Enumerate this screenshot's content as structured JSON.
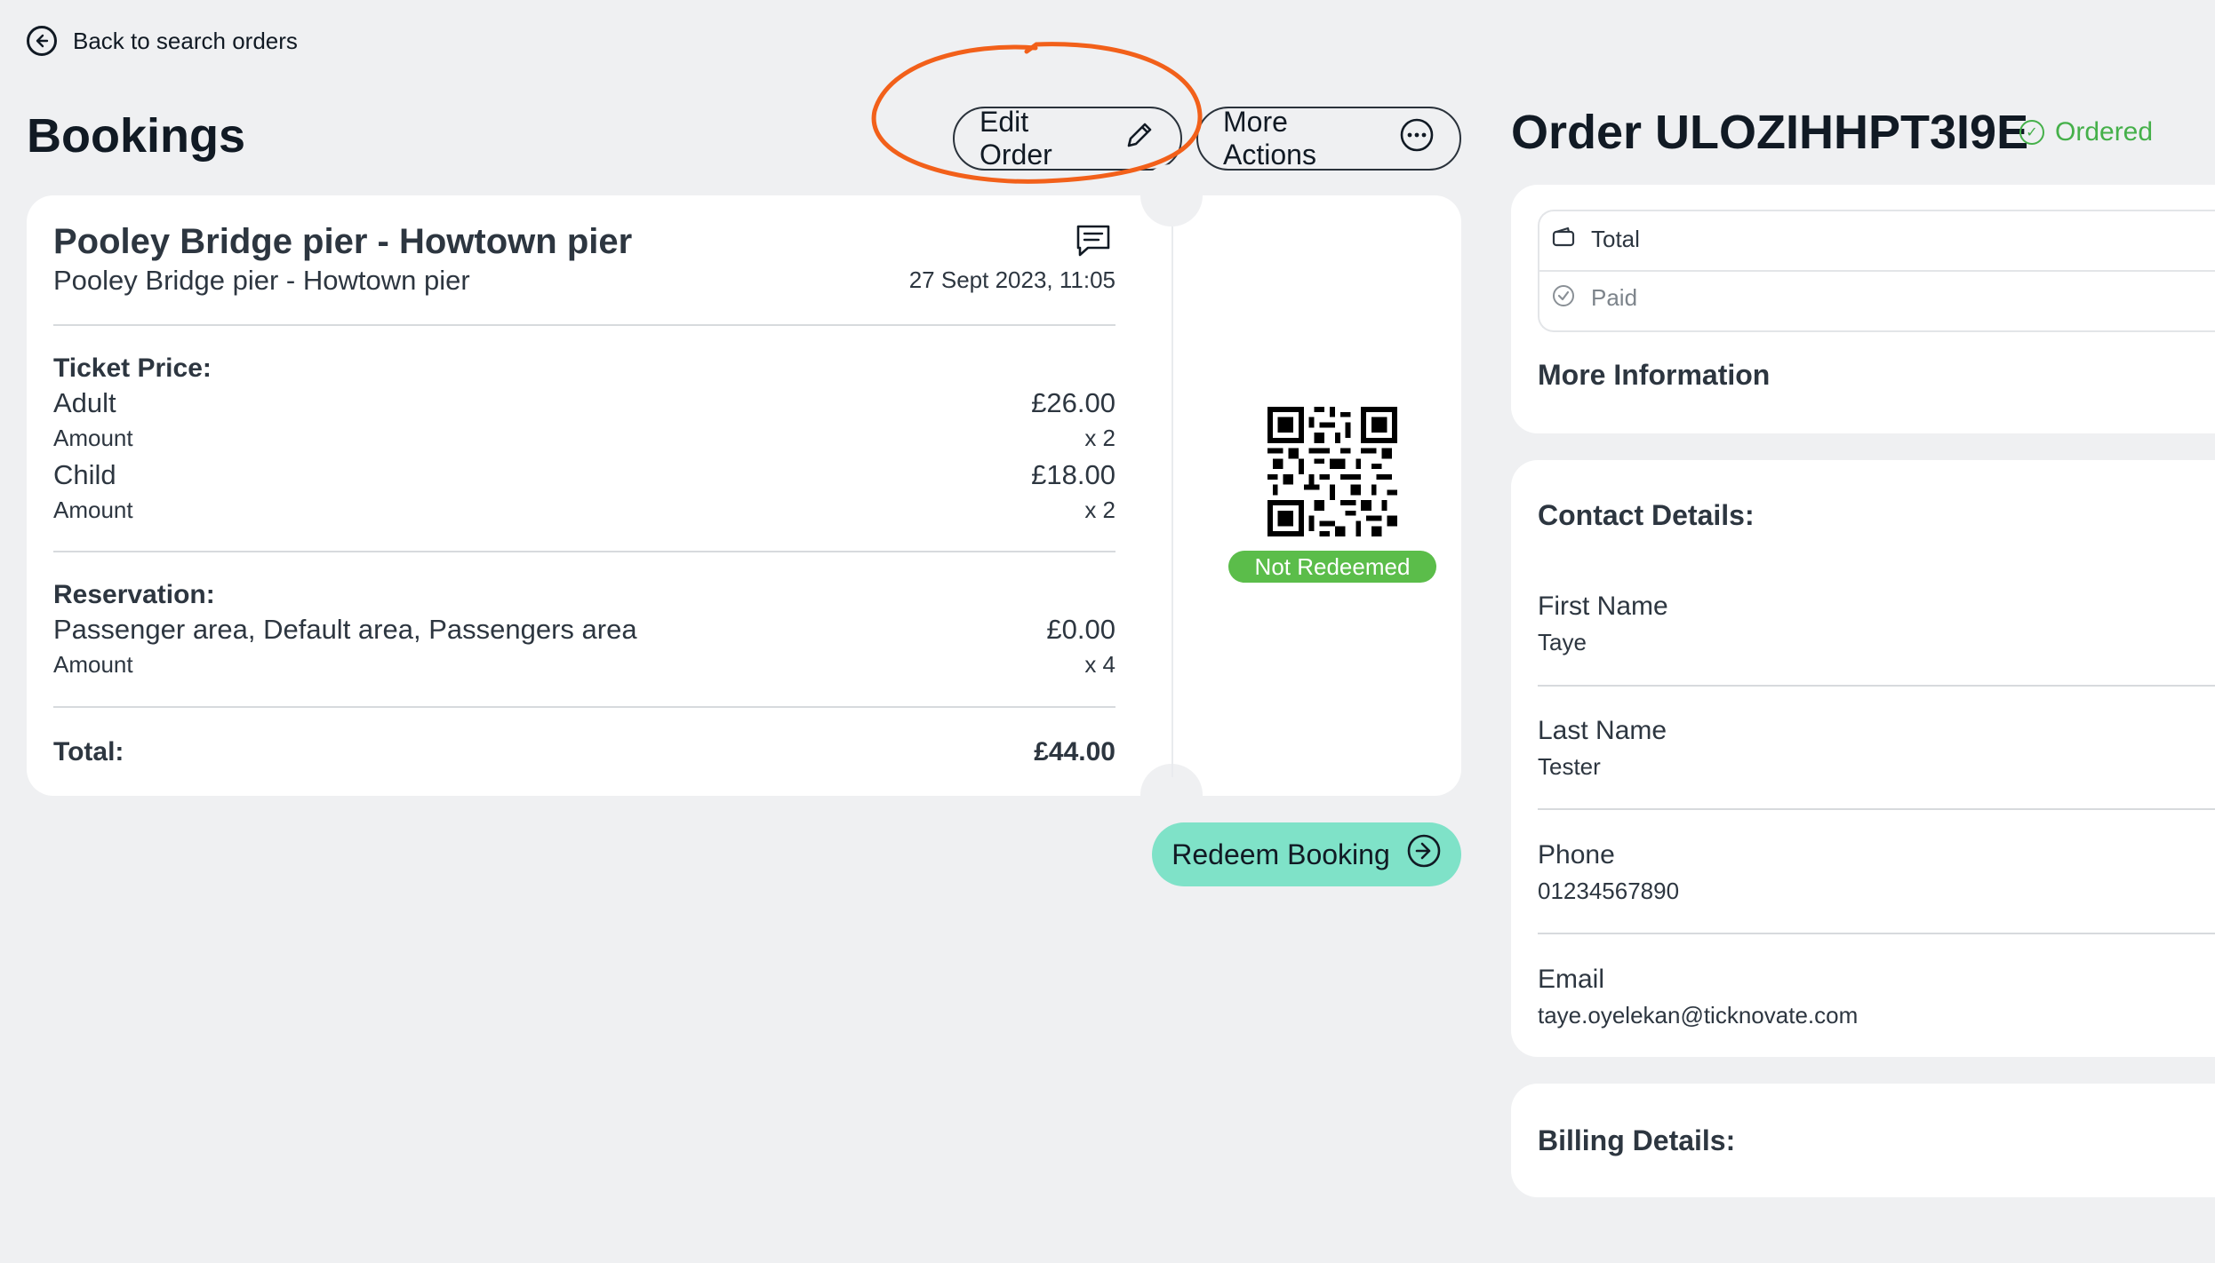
{
  "nav": {
    "back_label": "Back to search orders"
  },
  "page": {
    "title": "Bookings"
  },
  "actions": {
    "edit_order": "Edit Order",
    "more_actions": "More Actions"
  },
  "booking": {
    "title": "Pooley Bridge pier - Howtown pier",
    "subtitle": "Pooley Bridge pier - Howtown pier",
    "datetime": "27 Sept 2023, 11:05",
    "ticket_price_label": "Ticket Price:",
    "tickets": [
      {
        "name": "Adult",
        "price": "£26.00",
        "amount_label": "Amount",
        "qty": "x 2"
      },
      {
        "name": "Child",
        "price": "£18.00",
        "amount_label": "Amount",
        "qty": "x 2"
      }
    ],
    "reservation_label": "Reservation:",
    "reservation": {
      "name": "Passenger area, Default area, Passengers area",
      "price": "£0.00",
      "amount_label": "Amount",
      "qty": "x 4"
    },
    "total_label": "Total:",
    "total_value": "£44.00",
    "status": "Not Redeemed",
    "redeem_label": "Redeem Booking"
  },
  "order": {
    "title": "Order ULOZIHHPT3I9E",
    "status": "Ordered",
    "total_label": "Total",
    "paid_label": "Paid",
    "more_info": "More Information"
  },
  "contact": {
    "heading": "Contact Details:",
    "fields": [
      {
        "label": "First Name",
        "value": "Taye"
      },
      {
        "label": "Last Name",
        "value": "Tester"
      },
      {
        "label": "Phone",
        "value": "01234567890"
      },
      {
        "label": "Email",
        "value": "taye.oyelekan@ticknovate.com"
      }
    ]
  },
  "billing": {
    "heading": "Billing Details:"
  },
  "colors": {
    "background": "#eff0f2",
    "annotation": "#f2601a",
    "not_redeemed_badge": "#5bbd4a",
    "ordered_status": "#45b04a",
    "redeem_button": "#7fe2c8"
  },
  "icons": {
    "back": "arrow-left-circle-icon",
    "edit": "pencil-icon",
    "more": "ellipsis-circle-icon",
    "comment": "comment-icon",
    "redeem": "arrow-right-circle-icon",
    "wallet": "wallet-icon",
    "paid": "check-circle-icon",
    "qr": "qr-code"
  }
}
